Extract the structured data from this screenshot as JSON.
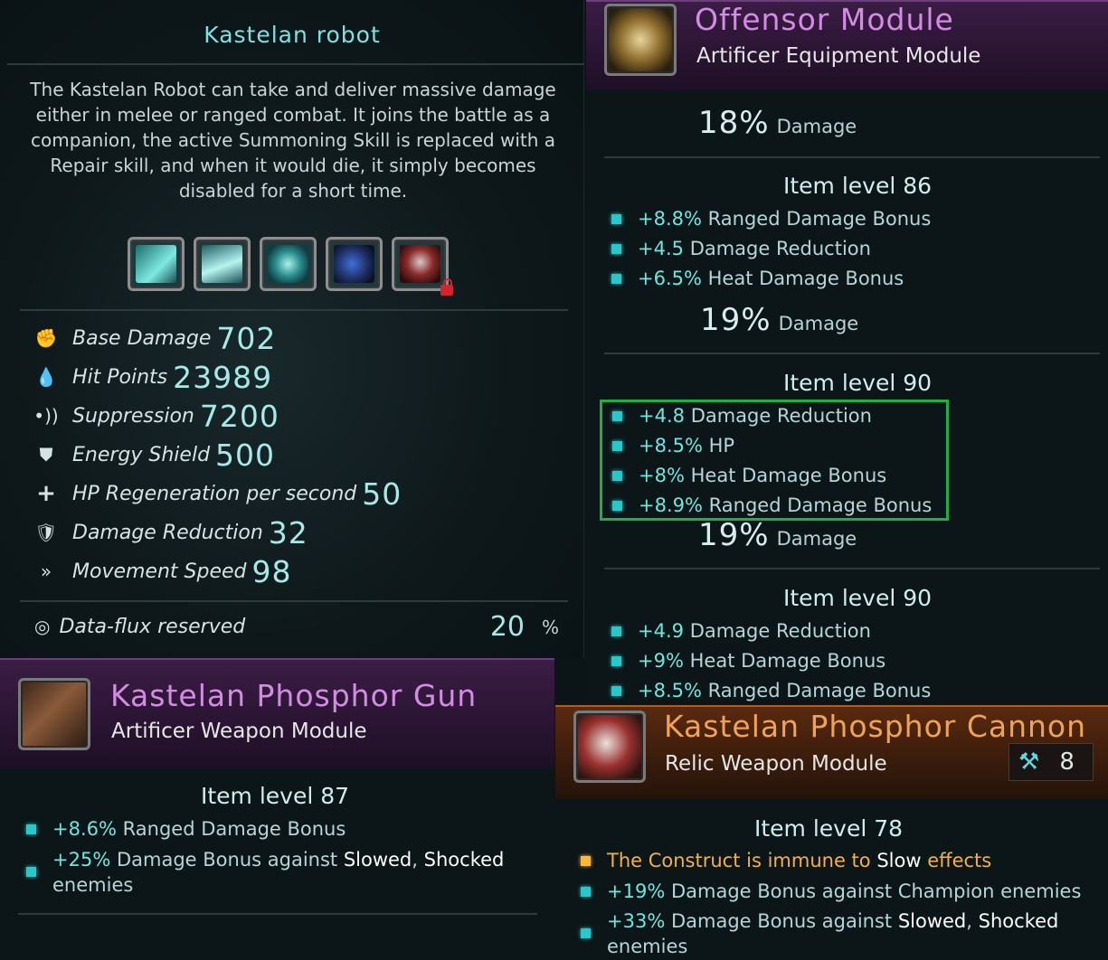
{
  "robot": {
    "title": "Kastelan robot",
    "description": "The Kastelan Robot can take and deliver massive damage either in melee or ranged combat. It joins the battle as a companion, the active Summoning Skill is replaced with a Repair skill, and when it would die, it simply becomes disabled for a short time.",
    "skills": [
      "skill-slot-1",
      "skill-slot-2",
      "skill-slot-3",
      "skill-slot-4",
      "skill-slot-5-locked"
    ],
    "stats": [
      {
        "icon": "fist-icon",
        "label": "Base Damage",
        "value": "702"
      },
      {
        "icon": "drop-icon",
        "label": "Hit Points",
        "value": "23989"
      },
      {
        "icon": "suppression-icon",
        "label": "Suppression",
        "value": "7200"
      },
      {
        "icon": "shield-icon",
        "label": "Energy Shield",
        "value": "500"
      },
      {
        "icon": "plus-icon",
        "label": "HP Regeneration per second",
        "value": "50"
      },
      {
        "icon": "armor-shield-icon",
        "label": "Damage Reduction",
        "value": "32"
      },
      {
        "icon": "speed-icon",
        "label": "Movement Speed",
        "value": "98"
      }
    ],
    "flux": {
      "label": "Data-flux reserved",
      "value": "20",
      "unit": "%"
    }
  },
  "offensor": {
    "title": "Offensor Module",
    "subtitle": "Artificer Equipment Module",
    "first_damage": {
      "value": "18%",
      "label": "Damage"
    },
    "levels": [
      {
        "title": "Item level 86",
        "bullets": [
          {
            "num": "+8.8%",
            "text": "Ranged Damage Bonus"
          },
          {
            "num": "+4.5",
            "text": "Damage Reduction"
          },
          {
            "num": "+6.5%",
            "text": "Heat Damage Bonus"
          }
        ],
        "damage": {
          "value": "19%",
          "label": "Damage"
        }
      },
      {
        "title": "Item level 90",
        "bullets": [
          {
            "num": "+4.8",
            "text": "Damage Reduction"
          },
          {
            "num": "+8.5%",
            "text": "HP"
          },
          {
            "num": "+8%",
            "text": "Heat Damage Bonus"
          },
          {
            "num": "+8.9%",
            "text": "Ranged Damage Bonus"
          }
        ],
        "damage": {
          "value": "19%",
          "label": "Damage"
        }
      },
      {
        "title": "Item level 90",
        "bullets": [
          {
            "num": "+4.9",
            "text": "Damage Reduction"
          },
          {
            "num": "+9%",
            "text": "Heat Damage Bonus"
          },
          {
            "num": "+8.5%",
            "text": "Ranged Damage Bonus"
          }
        ]
      }
    ]
  },
  "gun": {
    "title": "Kastelan Phosphor Gun",
    "subtitle": "Artificer Weapon Module",
    "level": "Item level 87",
    "b1_num": "+8.6%",
    "b1_text": "Ranged Damage Bonus",
    "b2_num": "+25%",
    "b2_text": "Damage Bonus against",
    "b2_hl1": "Slowed",
    "b2_sep": ",",
    "b2_hl2": "Shocked",
    "b2_tail": "enemies"
  },
  "cannon": {
    "title": "Kastelan Phosphor Cannon",
    "subtitle": "Relic Weapon Module",
    "count_icon": "hammer-icon",
    "count": "8",
    "level": "Item level 78",
    "b1_a": "The Construct is immune to",
    "b1_b": "Slow",
    "b1_c": "effects",
    "b2_num": "+19%",
    "b2_text": "Damage Bonus against Champion enemies",
    "b3_num": "+33%",
    "b3_text": "Damage Bonus against",
    "b3_hl1": "Slowed",
    "b3_sep": ",",
    "b3_hl2": "Shocked",
    "b3_tail": "enemies"
  },
  "colors": {
    "accent_cyan": "#6ee5e0",
    "artificer_purple": "#d58be6",
    "relic_orange": "#f0a356",
    "highlight_green": "#1fae4a"
  }
}
